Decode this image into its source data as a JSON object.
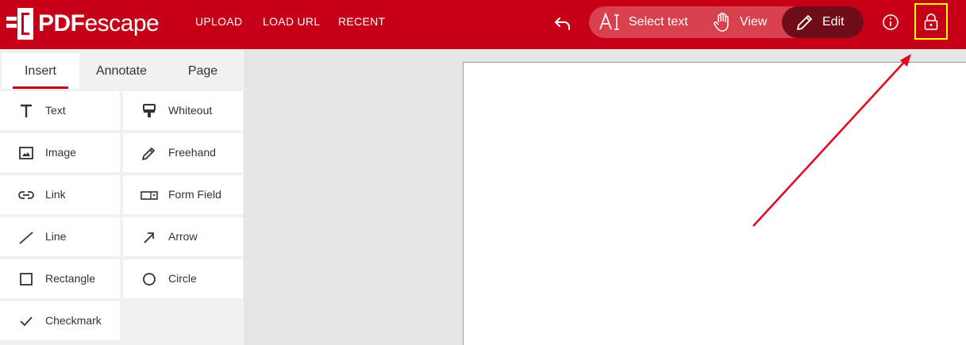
{
  "app": {
    "logo_pdf": "PDF",
    "logo_escape": "escape"
  },
  "nav": [
    {
      "label": "UPLOAD"
    },
    {
      "label": "LOAD URL"
    },
    {
      "label": "RECENT"
    }
  ],
  "modes": [
    {
      "label": "Select text",
      "icon": "select-text-icon"
    },
    {
      "label": "View",
      "icon": "hand-icon"
    },
    {
      "label": "Edit",
      "icon": "pencil-icon",
      "active": true
    }
  ],
  "tabs": [
    {
      "label": "Insert",
      "active": true
    },
    {
      "label": "Annotate"
    },
    {
      "label": "Page"
    }
  ],
  "tools": [
    {
      "label": "Text",
      "icon": "text-icon"
    },
    {
      "label": "Whiteout",
      "icon": "whiteout-icon"
    },
    {
      "label": "Image",
      "icon": "image-icon"
    },
    {
      "label": "Freehand",
      "icon": "freehand-icon"
    },
    {
      "label": "Link",
      "icon": "link-icon"
    },
    {
      "label": "Form Field",
      "icon": "form-field-icon"
    },
    {
      "label": "Line",
      "icon": "line-icon"
    },
    {
      "label": "Arrow",
      "icon": "arrow-icon"
    },
    {
      "label": "Rectangle",
      "icon": "rectangle-icon"
    },
    {
      "label": "Circle",
      "icon": "circle-icon"
    },
    {
      "label": "Checkmark",
      "icon": "checkmark-icon"
    }
  ],
  "colors": {
    "brand": "#c60017",
    "mode_group": "#d8404e",
    "mode_active": "#6e0c17",
    "highlight": "#ffff00",
    "annotation": "#e8001c"
  }
}
